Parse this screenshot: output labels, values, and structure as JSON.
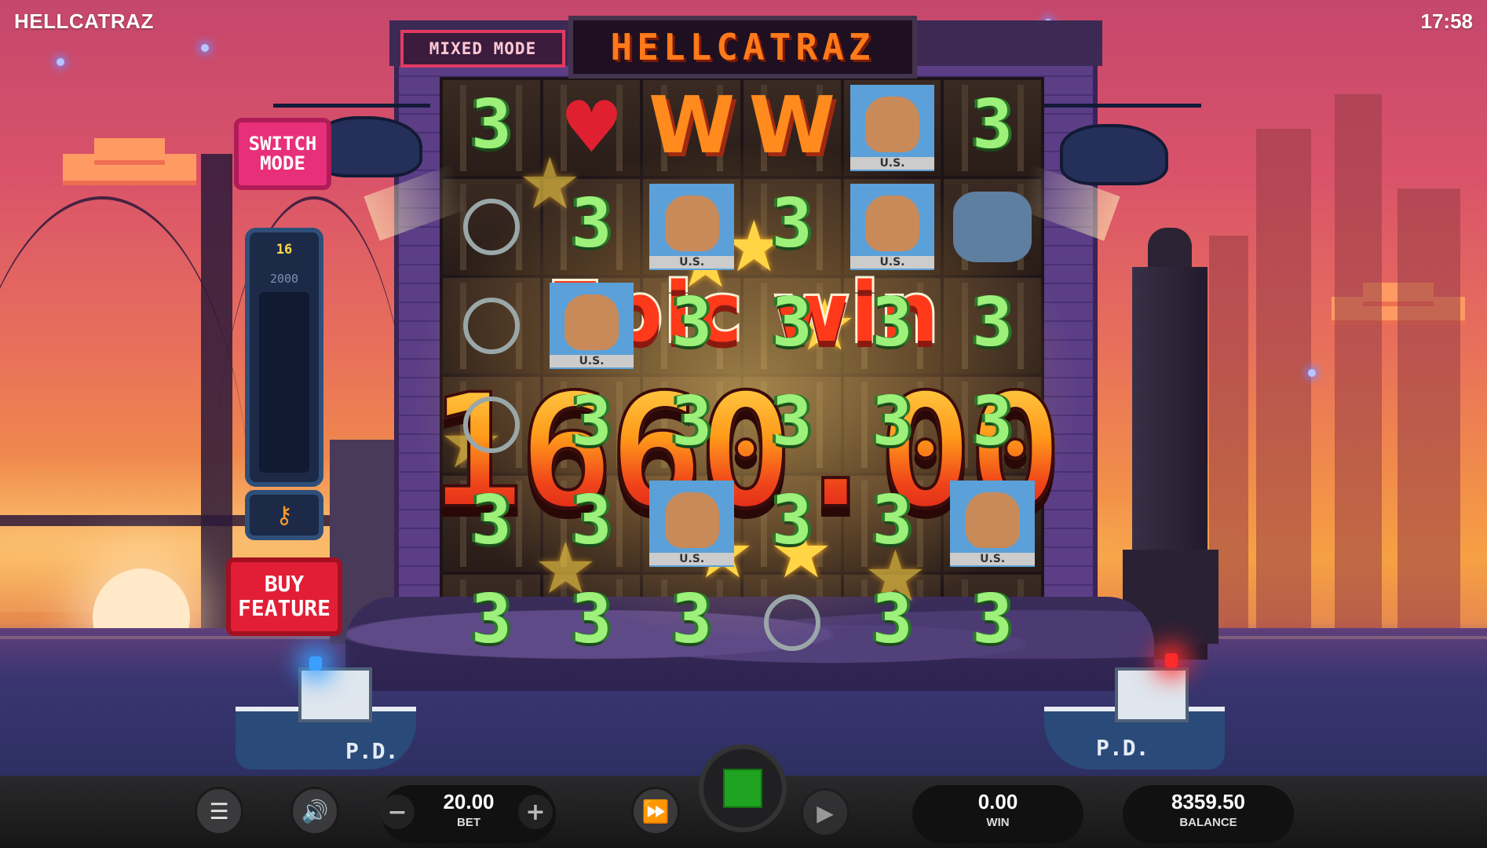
{
  "top_bar": {
    "title": "HELLCATRAZ",
    "clock": "17:58"
  },
  "machine": {
    "mode_label": "MIXED MODE",
    "title_label": "HELLCATRAZ",
    "grid": [
      [
        "3",
        "heart",
        "W",
        "W",
        "face",
        "3"
      ],
      [
        "cuffs",
        "3",
        "face",
        "3",
        "face",
        "shark"
      ],
      [
        "cuffs",
        "face",
        "3",
        "3",
        "3",
        "3"
      ],
      [
        "cuffs",
        "3",
        "3",
        "3",
        "3",
        "3"
      ],
      [
        "3",
        "3",
        "face",
        "3",
        "3",
        "face"
      ],
      [
        "3",
        "3",
        "3",
        "cuffs",
        "3",
        "3"
      ]
    ],
    "face_badge": "U.S."
  },
  "side_panel": {
    "switch_mode_label": "SWITCH\nMODE",
    "meter_count": "16",
    "meter_cap": "2000",
    "key_icon": "key-icon",
    "buy_feature_label": "BUY\nFEATURE"
  },
  "scene": {
    "boat_left_label": "P.D.",
    "boat_right_label": "P.D.",
    "siren_left_color": "#3aa0ff",
    "siren_right_color": "#ff2a2a"
  },
  "win_overlay": {
    "title": "Epic win",
    "amount": "1660.00"
  },
  "controls": {
    "menu_icon": "menu-icon",
    "sound_icon": "speaker-icon",
    "bet": {
      "value": "20.00",
      "label": "BET",
      "minus": "−",
      "plus": "+"
    },
    "fast_forward_icon": "fast-forward-icon",
    "stop_icon": "stop-icon",
    "autoplay_icon": "autoplay-icon",
    "win": {
      "value": "0.00",
      "label": "WIN"
    },
    "balance": {
      "value": "8359.50",
      "label": "BALANCE"
    },
    "accent_green": "#1fa21f"
  }
}
